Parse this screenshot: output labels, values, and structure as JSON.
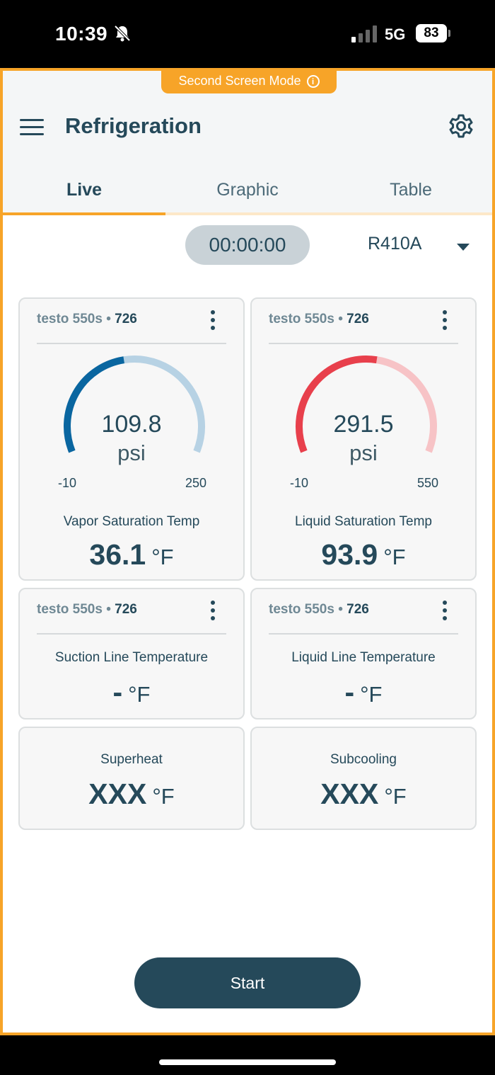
{
  "status_bar": {
    "time": "10:39",
    "network": "5G",
    "battery": "83"
  },
  "banner": {
    "label": "Second Screen Mode",
    "info_icon": "i"
  },
  "header": {
    "title": "Refrigeration"
  },
  "tabs": [
    {
      "label": "Live"
    },
    {
      "label": "Graphic"
    },
    {
      "label": "Table"
    }
  ],
  "timer": "00:00:00",
  "refrigerant": "R410A",
  "cards": [
    {
      "device": "testo 550s",
      "separator": "•",
      "serial": "726",
      "gauge": {
        "value": "109.8",
        "unit": "psi",
        "min": "-10",
        "max": "250",
        "fraction": 0.46,
        "color": "#0a66a0",
        "track": "#b7d2e4"
      },
      "label": "Vapor Saturation Temp",
      "value": "36.1",
      "unit": "°F"
    },
    {
      "device": "testo 550s",
      "separator": "•",
      "serial": "726",
      "gauge": {
        "value": "291.5",
        "unit": "psi",
        "min": "-10",
        "max": "550",
        "fraction": 0.54,
        "color": "#e8404c",
        "track": "#f7c3c6"
      },
      "label": "Liquid Saturation Temp",
      "value": "93.9",
      "unit": "°F"
    },
    {
      "device": "testo 550s",
      "separator": "•",
      "serial": "726",
      "label": "Suction Line Temperature",
      "value": "-",
      "unit": "°F"
    },
    {
      "device": "testo 550s",
      "separator": "•",
      "serial": "726",
      "label": "Liquid Line Temperature",
      "value": "-",
      "unit": "°F"
    },
    {
      "label": "Superheat",
      "value": "XXX",
      "unit": "°F"
    },
    {
      "label": "Subcooling",
      "value": "XXX",
      "unit": "°F"
    }
  ],
  "start_button": "Start"
}
